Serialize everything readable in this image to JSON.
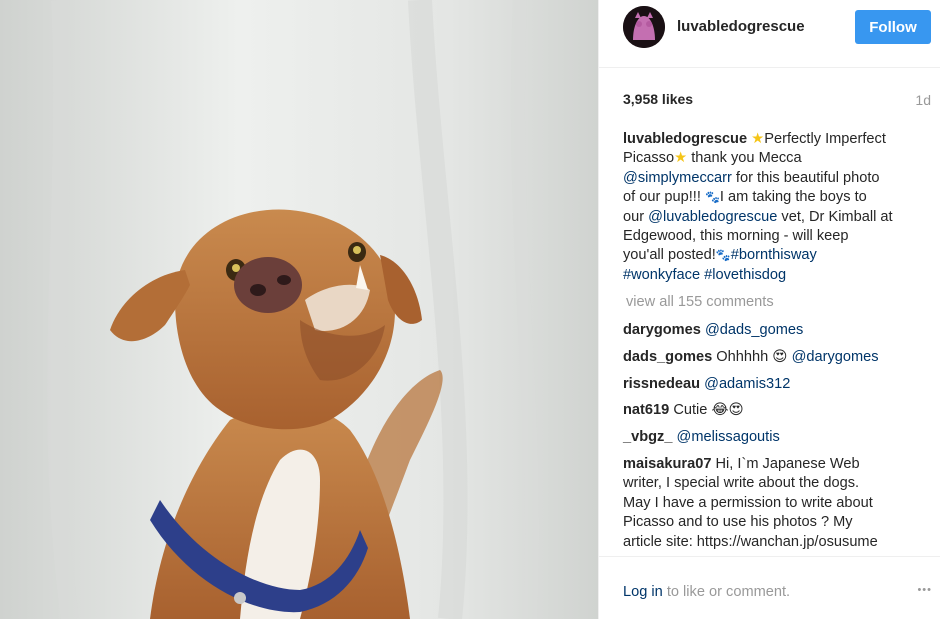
{
  "profile": {
    "username": "luvabledogrescue",
    "follow_label": "Follow"
  },
  "post": {
    "likes": "3,958 likes",
    "time": "1d",
    "caption": {
      "username": "luvabledogrescue",
      "line1_text": "Perfectly Imperfect",
      "line2_a": "Picasso",
      "line2_b": " thank you Mecca",
      "line3_link": "@simplymeccarr",
      "line3_text": " for this beautiful photo",
      "line4_a": "of our pup!!! ",
      "line4_b": "I am taking the boys to",
      "line5_a": "our ",
      "line5_link": "@luvabledogrescue",
      "line5_b": " vet, Dr Kimball at",
      "line6": "Edgewood, this morning - will keep",
      "line7_a": "you'all posted!",
      "line7_link": "#bornthisway",
      "line8_link1": "#wonkyface",
      "line8_link2": "#lovethisdog",
      "star_emoji": "★",
      "paw_emoji": "🐾"
    },
    "view_all_comments": "view all 155 comments"
  },
  "comments": [
    {
      "user": "darygomes",
      "text": "",
      "mention": "@dads_gomes"
    },
    {
      "user": "dads_gomes",
      "text": "Ohhhhh ",
      "emoji": "😍",
      "mention": "@darygomes"
    },
    {
      "user": "rissnedeau",
      "text": "",
      "mention": "@adamis312"
    },
    {
      "user": "nat619",
      "text": "Cutie ",
      "emoji": "😂😍"
    },
    {
      "user": "_vbgz_",
      "text": "",
      "mention": "@melissagoutis"
    },
    {
      "user": "maisakura07",
      "line1": "Hi, I`m Japanese Web",
      "line2": "writer, I special write about the dogs.",
      "line3": "May I have a permission to write about",
      "line4": "Picasso and to use his photos ? My",
      "line5": "article site: https://wanchan.jp/osusume"
    }
  ],
  "footer": {
    "login_link": "Log in",
    "login_text": " to like or comment.",
    "more_icon": "•••"
  },
  "colors": {
    "accent": "#3897f0",
    "link": "#003569",
    "muted": "#999999"
  },
  "icons": {
    "more": "more-options-icon",
    "avatar": "avatar-image"
  }
}
